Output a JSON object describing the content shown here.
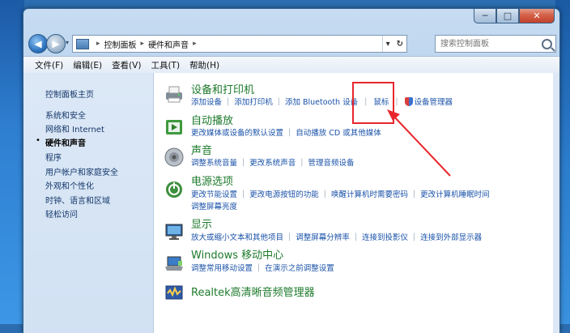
{
  "window": {
    "controls": {
      "minimize": "─",
      "maximize": "□",
      "close": "✕"
    }
  },
  "address": {
    "back": "◀",
    "forward": "▶",
    "crumbs": [
      "控制面板",
      "硬件和声音"
    ],
    "dropdown": "▾",
    "refresh": "↻"
  },
  "search": {
    "placeholder": "搜索控制面板"
  },
  "menu": [
    "文件(F)",
    "编辑(E)",
    "查看(V)",
    "工具(T)",
    "帮助(H)"
  ],
  "sidebar": {
    "home": "控制面板主页",
    "items": [
      "系统和安全",
      "网络和 Internet",
      "硬件和声音",
      "程序",
      "用户帐户和家庭安全",
      "外观和个性化",
      "时钟、语言和区域",
      "轻松访问"
    ],
    "active_index": 2,
    "bullet": "•"
  },
  "categories": [
    {
      "title": "设备和打印机",
      "icon": "printer-icon",
      "tasks": [
        "添加设备",
        "添加打印机",
        "添加 Bluetooth 设备",
        "鼠标",
        "设备管理器"
      ]
    },
    {
      "title": "自动播放",
      "icon": "autoplay-icon",
      "tasks": [
        "更改媒体或设备的默认设置",
        "自动播放 CD 或其他媒体"
      ]
    },
    {
      "title": "声音",
      "icon": "speaker-icon",
      "tasks": [
        "调整系统音量",
        "更改系统声音",
        "管理音频设备"
      ]
    },
    {
      "title": "电源选项",
      "icon": "power-icon",
      "tasks": [
        "更改节能设置",
        "更改电源按钮的功能",
        "唤醒计算机时需要密码",
        "更改计算机睡眠时间"
      ],
      "tasks2": [
        "调整屏幕亮度"
      ]
    },
    {
      "title": "显示",
      "icon": "display-icon",
      "tasks": [
        "放大或缩小文本和其他项目",
        "调整屏幕分辨率",
        "连接到投影仪",
        "连接到外部显示器"
      ]
    },
    {
      "title": "Windows 移动中心",
      "icon": "mobility-center-icon",
      "tasks": [
        "调整常用移动设置",
        "在演示之前调整设置"
      ]
    },
    {
      "title": "Realtek高清晰音频管理器",
      "icon": "realtek-icon",
      "tasks": []
    }
  ],
  "colors": {
    "link": "#1a52a8",
    "title": "#1d7a2c",
    "highlight": "#e8262c"
  }
}
